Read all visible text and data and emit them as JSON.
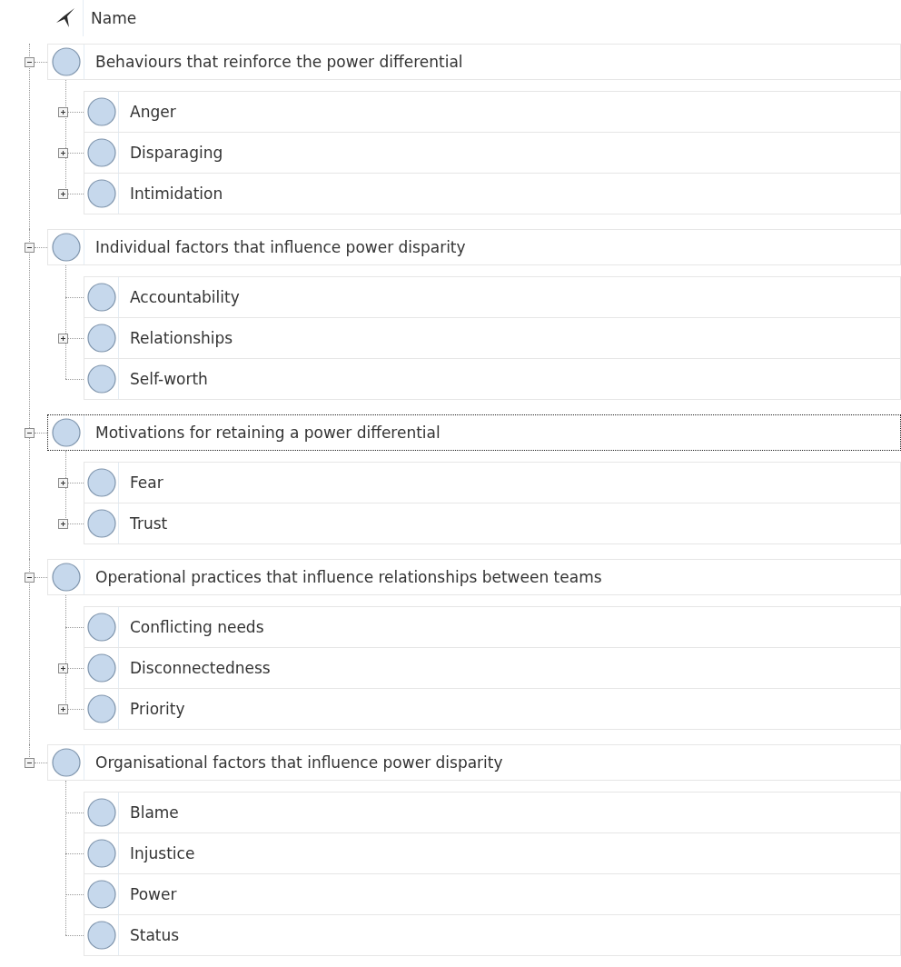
{
  "header": {
    "column": "Name"
  },
  "groups": [
    {
      "name": "Behaviours that reinforce the power differential",
      "expanded": true,
      "selected": false,
      "children": [
        {
          "name": "Anger",
          "kind": "branch",
          "expanded": false,
          "selected": false
        },
        {
          "name": "Disparaging",
          "kind": "branch",
          "expanded": false,
          "selected": false
        },
        {
          "name": "Intimidation",
          "kind": "branch",
          "expanded": false,
          "selected": false
        }
      ]
    },
    {
      "name": "Individual factors that influence power disparity",
      "expanded": true,
      "selected": false,
      "children": [
        {
          "name": "Accountability",
          "kind": "leaf",
          "selected": false
        },
        {
          "name": "Relationships",
          "kind": "branch",
          "expanded": false,
          "selected": false
        },
        {
          "name": "Self-worth",
          "kind": "leaf",
          "selected": false
        }
      ]
    },
    {
      "name": "Motivations for retaining a power differential",
      "expanded": true,
      "selected": true,
      "children": [
        {
          "name": "Fear",
          "kind": "branch",
          "expanded": false,
          "selected": false
        },
        {
          "name": "Trust",
          "kind": "branch",
          "expanded": false,
          "selected": false
        }
      ]
    },
    {
      "name": "Operational practices that influence relationships between teams",
      "expanded": true,
      "selected": false,
      "children": [
        {
          "name": "Conflicting needs",
          "kind": "leaf",
          "selected": false
        },
        {
          "name": "Disconnectedness",
          "kind": "branch",
          "expanded": false,
          "selected": false
        },
        {
          "name": "Priority",
          "kind": "branch",
          "expanded": false,
          "selected": false
        }
      ]
    },
    {
      "name": "Organisational factors that influence power disparity",
      "expanded": true,
      "selected": false,
      "children": [
        {
          "name": "Blame",
          "kind": "leaf",
          "selected": false
        },
        {
          "name": "Injustice",
          "kind": "leaf",
          "selected": false
        },
        {
          "name": "Power",
          "kind": "leaf",
          "selected": false
        },
        {
          "name": "Status",
          "kind": "leaf",
          "selected": false
        }
      ]
    }
  ]
}
